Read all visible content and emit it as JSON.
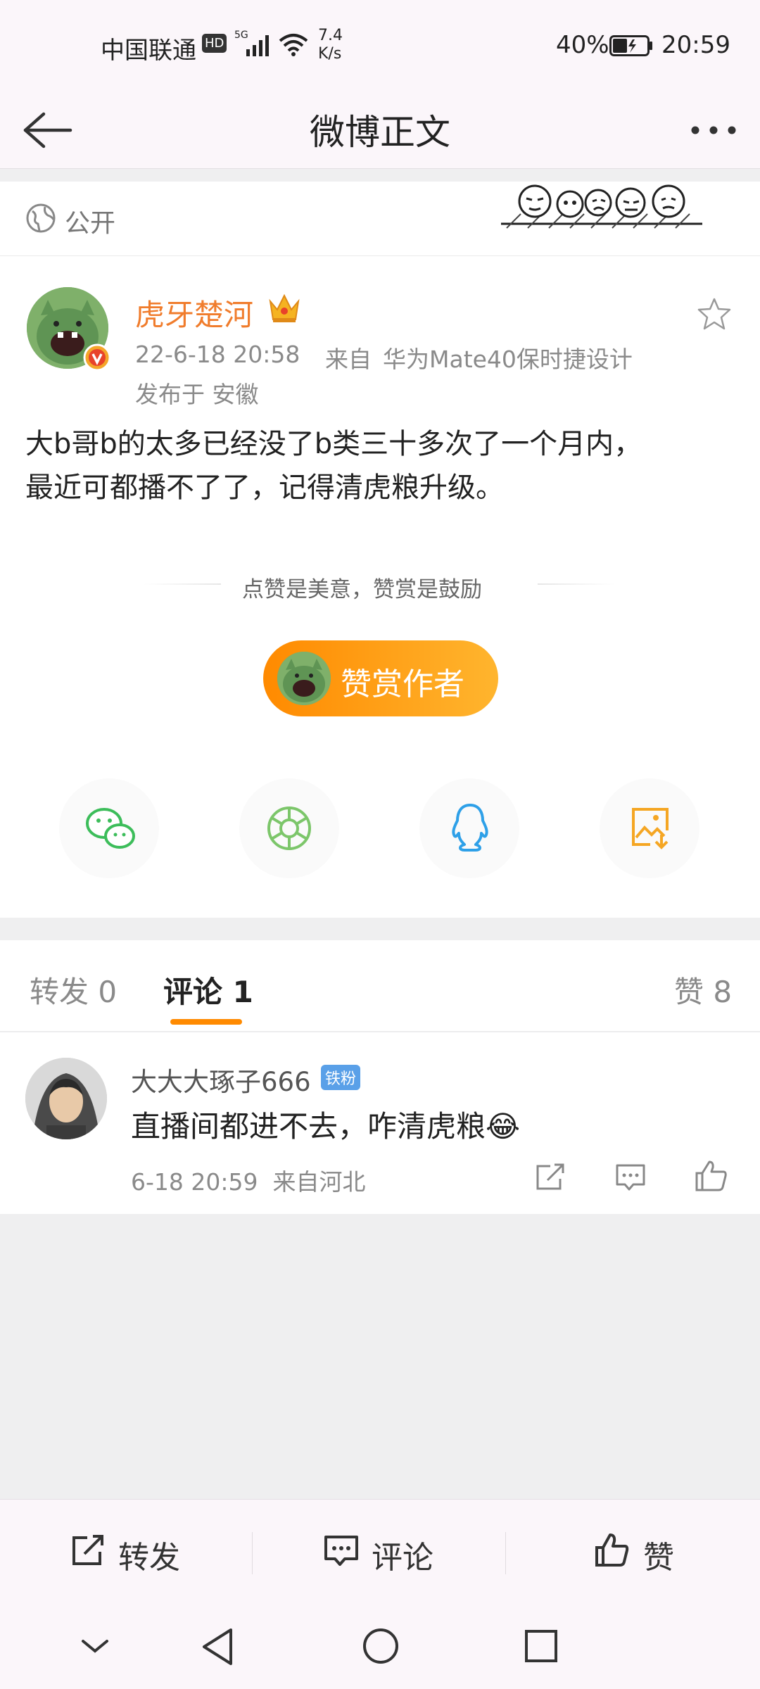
{
  "status_bar": {
    "carrier": "中国联通",
    "hd_badge": "HD",
    "net_type": "5G",
    "speed_value": "7.4",
    "speed_unit": "K/s",
    "battery": "40%",
    "time": "20:59"
  },
  "nav": {
    "title": "微博正文",
    "back_icon": "arrow-left-icon",
    "more_icon": "more-dots-icon"
  },
  "visibility": {
    "label": "公开",
    "icon": "globe-icon"
  },
  "post": {
    "username": "虎牙楚河",
    "timestamp": "22-6-18 20:58",
    "source_prefix": "来自",
    "source": "华为Mate40保时捷设计",
    "location": "发布于 安徽",
    "content_line1": "大b哥b的太多已经没了b类三十多次了一个月内，",
    "content_line2": "最近可都播不了了，记得清虎粮升级。",
    "reward_tip": "点赞是美意，赞赏是鼓励",
    "reward_button": "赞赏作者"
  },
  "share": [
    {
      "icon": "wechat-icon",
      "color": "#3cbd5a"
    },
    {
      "icon": "moments-icon",
      "color": "#7cc66a"
    },
    {
      "icon": "qq-icon",
      "color": "#2ea0e8"
    },
    {
      "icon": "save-image-icon",
      "color": "#f5a623"
    }
  ],
  "tabs": {
    "repost": "转发 0",
    "comment": "评论 1",
    "like": "赞 8"
  },
  "comment": {
    "name": "大大大琢子666",
    "badge": "铁粉",
    "text": "直播间都进不去，咋清虎粮😂",
    "meta": "6-18 20:59  来自河北"
  },
  "actions": {
    "repost": "转发",
    "comment": "评论",
    "like": "赞"
  },
  "colors": {
    "accent_orange": "#ff8a00",
    "username": "#f07c2c",
    "source_link": "#5a7fa8"
  }
}
